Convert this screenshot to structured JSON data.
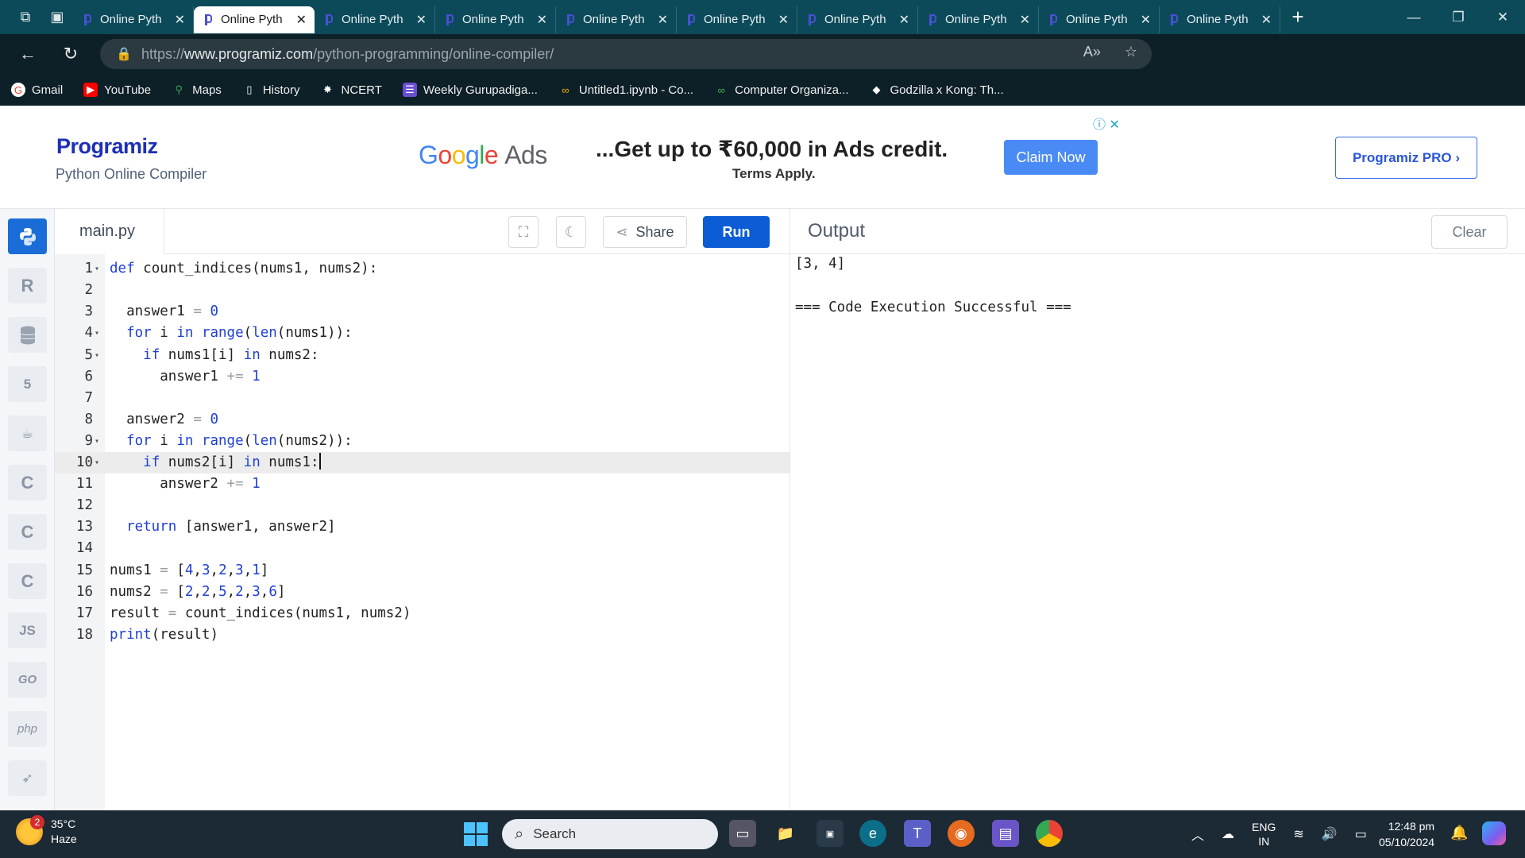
{
  "browser": {
    "tabs": [
      {
        "title": "Online Pyth"
      },
      {
        "title": "Online Pyth"
      },
      {
        "title": "Online Pyth"
      },
      {
        "title": "Online Pyth"
      },
      {
        "title": "Online Pyth"
      },
      {
        "title": "Online Pyth"
      },
      {
        "title": "Online Pyth"
      },
      {
        "title": "Online Pyth"
      },
      {
        "title": "Online Pyth"
      },
      {
        "title": "Online Pyth"
      }
    ],
    "active_tab_index": 1,
    "url_scheme": "https://",
    "url_host": "www.programiz.com",
    "url_path": "/python-programming/online-compiler/",
    "bookmarks": [
      {
        "label": "Gmail",
        "icon": "gmail-icon"
      },
      {
        "label": "YouTube",
        "icon": "youtube-icon"
      },
      {
        "label": "Maps",
        "icon": "maps-icon"
      },
      {
        "label": "History",
        "icon": "page-icon"
      },
      {
        "label": "NCERT",
        "icon": "ncert-icon"
      },
      {
        "label": "Weekly Gurupadiga...",
        "icon": "list-icon"
      },
      {
        "label": "Untitled1.ipynb - Co...",
        "icon": "colab-icon"
      },
      {
        "label": "Computer Organiza...",
        "icon": "infinity-icon"
      },
      {
        "label": "Godzilla x Kong: Th...",
        "icon": "movie-icon"
      }
    ]
  },
  "header": {
    "logo": "Programiz",
    "subtitle": "Python Online Compiler",
    "ad": {
      "brand_google": "Google",
      "brand_ads": "Ads",
      "headline": "...Get up to ₹60,000 in Ads credit.",
      "subline": "Terms Apply.",
      "cta": "Claim Now"
    },
    "pro_button": "Programiz PRO ›"
  },
  "languages": [
    {
      "name": "python-icon",
      "label": "",
      "active": true
    },
    {
      "name": "r-icon",
      "label": "R"
    },
    {
      "name": "sql-icon",
      "label": ""
    },
    {
      "name": "html-icon",
      "label": "5"
    },
    {
      "name": "java-icon",
      "label": "☕"
    },
    {
      "name": "c-icon",
      "label": "C"
    },
    {
      "name": "cpp-icon",
      "label": "C"
    },
    {
      "name": "csharp-icon",
      "label": "C"
    },
    {
      "name": "js-icon",
      "label": "JS"
    },
    {
      "name": "go-icon",
      "label": "GO"
    },
    {
      "name": "php-icon",
      "label": "php"
    },
    {
      "name": "swift-icon",
      "label": "➶"
    }
  ],
  "editor": {
    "filename": "main.py",
    "share_label": "Share",
    "run_label": "Run",
    "current_line": 10,
    "lines": [
      "def count_indices(nums1, nums2):",
      "",
      "  answer1 = 0",
      "  for i in range(len(nums1)):",
      "    if nums1[i] in nums2:",
      "      answer1 += 1",
      "",
      "  answer2 = 0",
      "  for i in range(len(nums2)):",
      "    if nums2[i] in nums1:",
      "      answer2 += 1",
      "",
      "  return [answer1, answer2]",
      "",
      "nums1 = [4,3,2,3,1]",
      "nums2 = [2,2,5,2,3,6]",
      "result = count_indices(nums1, nums2)",
      "print(result)"
    ],
    "foldable_lines": [
      1,
      4,
      5,
      9,
      10
    ]
  },
  "output": {
    "title": "Output",
    "clear_label": "Clear",
    "lines": [
      "[3, 4]",
      "",
      "=== Code Execution Successful ==="
    ]
  },
  "taskbar": {
    "weather_temp": "35°C",
    "weather_desc": "Haze",
    "weather_badge": "2",
    "search_placeholder": "Search",
    "language": "ENG",
    "region": "IN",
    "time": "12:48 pm",
    "date": "05/10/2024"
  },
  "colors": {
    "run_button": "#0b5cd5",
    "keyword": "#1f3fd6",
    "active_language": "#1a6dd7"
  }
}
